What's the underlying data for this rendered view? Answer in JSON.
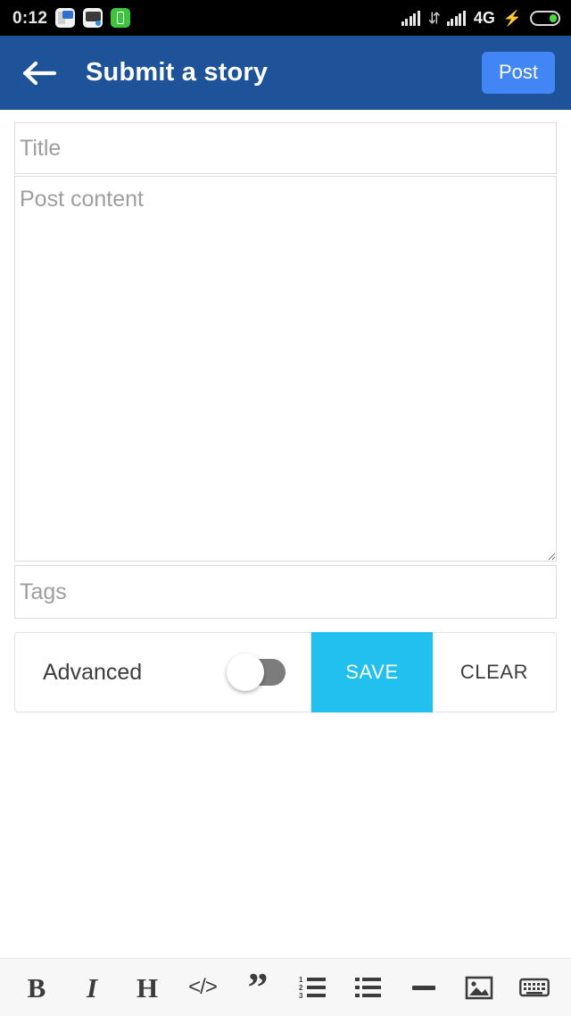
{
  "status_bar": {
    "time": "0:12",
    "network_label": "4G",
    "icons": {
      "news_app": "news-app-icon",
      "chat_app": "chat-app-icon",
      "battery_app": "battery-app-icon",
      "signal_1": "signal-bars-icon",
      "data_transfer": "data-transfer-arrows-icon",
      "signal_2": "signal-bars-icon",
      "charging": "charging-bolt-icon",
      "battery": "battery-icon"
    },
    "data_arrows_glyph": "⇵",
    "bolt_glyph": "⚡",
    "background_color": "#000000"
  },
  "app_bar": {
    "title": "Submit a story",
    "back_icon": "back-arrow-icon",
    "post_label": "Post",
    "background_color": "#1f5399",
    "post_button_color": "#4285f4"
  },
  "form": {
    "title_placeholder": "Title",
    "title_value": "",
    "content_placeholder": "Post content",
    "content_value": "",
    "tags_placeholder": "Tags",
    "tags_value": ""
  },
  "actions": {
    "advanced_label": "Advanced",
    "advanced_toggle_state": "off",
    "save_label": "SAVE",
    "clear_label": "CLEAR",
    "save_color": "#22c0ef"
  },
  "editor_toolbar": {
    "items": [
      {
        "name": "bold-icon",
        "glyph": "B"
      },
      {
        "name": "italic-icon",
        "glyph": "I"
      },
      {
        "name": "heading-icon",
        "glyph": "H"
      },
      {
        "name": "code-icon",
        "glyph": "</>"
      },
      {
        "name": "quote-icon",
        "glyph": "”"
      },
      {
        "name": "ordered-list-icon",
        "glyph": ""
      },
      {
        "name": "unordered-list-icon",
        "glyph": ""
      },
      {
        "name": "horizontal-rule-icon",
        "glyph": ""
      },
      {
        "name": "image-icon",
        "glyph": ""
      },
      {
        "name": "keyboard-icon",
        "glyph": ""
      }
    ]
  }
}
